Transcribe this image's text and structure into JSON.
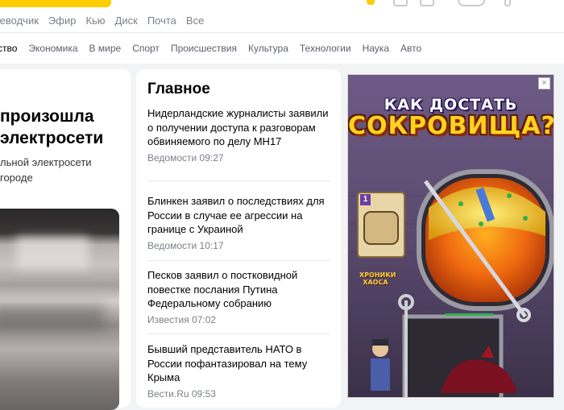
{
  "top_nav": {
    "items": [
      "Путеводчик",
      "Эфир",
      "Кью",
      "Диск",
      "Почта",
      "Все"
    ]
  },
  "categories": {
    "items": [
      "Общество",
      "Экономика",
      "В мире",
      "Спорт",
      "Происшествия",
      "Культура",
      "Технологии",
      "Наука",
      "Авто"
    ],
    "active_index": 0,
    "visible_text": [
      "ство",
      "Экономика",
      "В мире",
      "Спорт",
      "Происшествия",
      "Культура",
      "Технологии",
      "Наука",
      "Авто"
    ]
  },
  "left_story": {
    "headline": "произошла электросети",
    "headline_line1": "произошла",
    "headline_line2": "электросети",
    "sub_line1": "льной электросети",
    "sub_line2": "городе"
  },
  "main": {
    "title": "Главное",
    "news": [
      {
        "text": "Нидерландские журналисты заявили о получении доступа к разговорам обвиняемого по делу MH17",
        "source": "Ведомости 09:27"
      },
      {
        "text": "Блинкен заявил о последствиях для России в случае ее агрессии на границе с Украиной",
        "source": "Ведомости 10:17"
      },
      {
        "text": "Песков заявил о постковидной повестке послания Путина Федеральному собранию",
        "source": "Известия 07:02"
      },
      {
        "text": "Бывший представитель НАТО в России пофантазировал на тему Крыма",
        "source": "Вести.Ru 09:53"
      }
    ]
  },
  "ad": {
    "title_line1": "КАК ДОСТАТЬ",
    "title_line2": "СОКРОВИЩА?",
    "logo_text": "ХРОНИКИ ХАОСА",
    "card_number": "1",
    "close_symbol": "×"
  },
  "colors": {
    "brand_yellow": "#ffcc00",
    "muted_text": "#7a7f87",
    "background": "#f2f3f5"
  }
}
